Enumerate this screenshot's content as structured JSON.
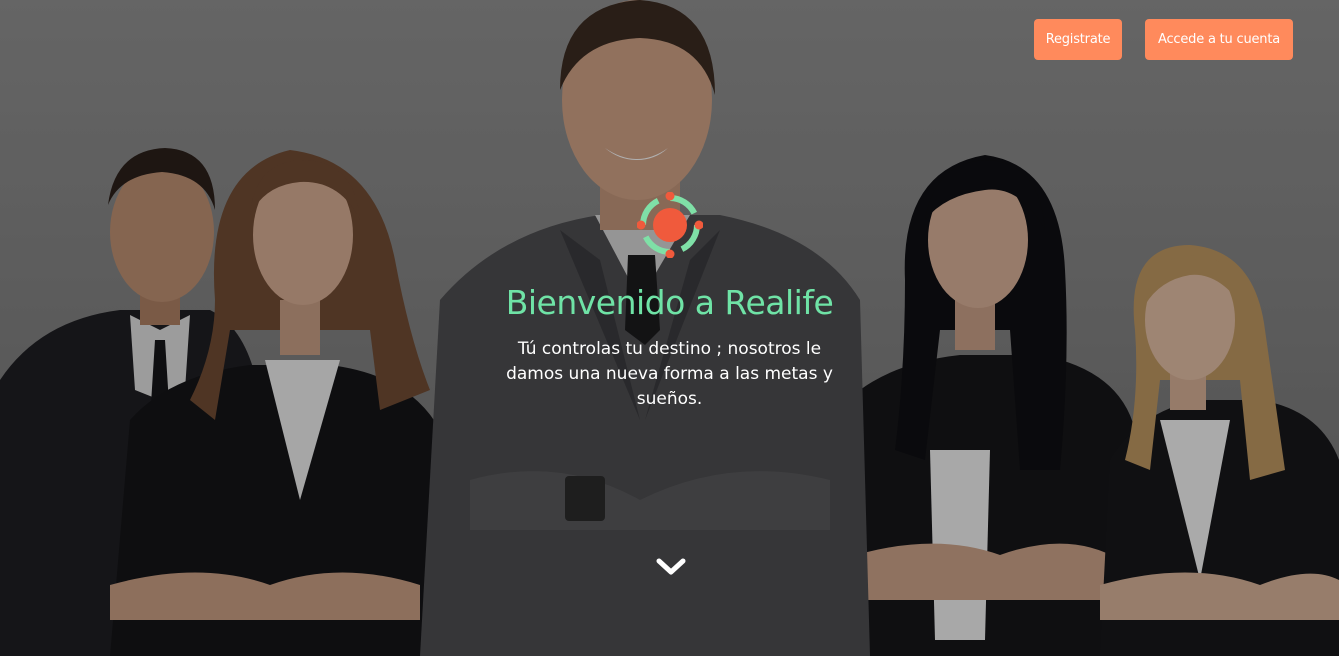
{
  "nav": {
    "register_label": "Registrate",
    "login_label": "Accede a tu cuenta"
  },
  "hero": {
    "title": "Bienvenido a Realife",
    "tagline": "Tú controlas tu destino ; nosotros le damos una nueva forma a las metas y sueños.",
    "image_description": "group-of-business-people-photo",
    "logo_icon": "realife-logo-icon",
    "scroll_icon": "chevron-down-icon"
  },
  "colors": {
    "accent_button": "#ff8a5c",
    "title_green": "#6fe3a6",
    "logo_red": "#f05a3c",
    "logo_green": "#7fe0a7"
  }
}
